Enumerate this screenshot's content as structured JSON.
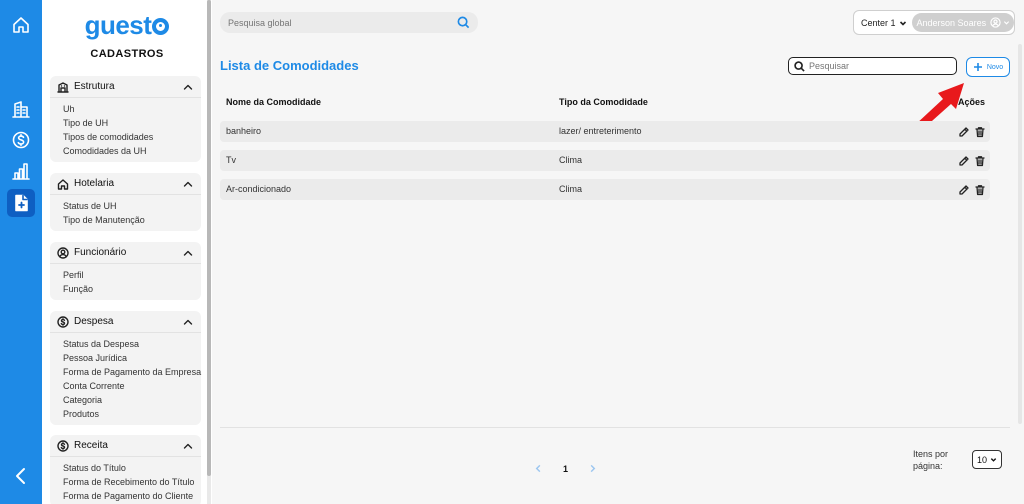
{
  "brand": {
    "text_pre": "guest"
  },
  "sidebar": {
    "title": "CADASTROS",
    "sections": [
      {
        "label": "Estrutura",
        "items": [
          "Uh",
          "Tipo de UH",
          "Tipos de comodidades",
          "Comodidades da UH"
        ]
      },
      {
        "label": "Hotelaria",
        "items": [
          "Status de UH",
          "Tipo de Manutenção"
        ]
      },
      {
        "label": "Funcionário",
        "items": [
          "Perfil",
          "Função"
        ]
      },
      {
        "label": "Despesa",
        "items": [
          "Status da Despesa",
          "Pessoa Jurídica",
          "Forma de Pagamento da Empresa",
          "Conta Corrente",
          "Categoria",
          "Produtos"
        ]
      },
      {
        "label": "Receita",
        "items": [
          "Status do Título",
          "Forma de Recebimento do Título",
          "Forma de Pagamento do Cliente"
        ]
      }
    ]
  },
  "header": {
    "global_search_placeholder": "Pesquisa global",
    "center": "Center 1",
    "user": "Anderson Soares"
  },
  "main": {
    "title": "Lista de Comodidades",
    "search_placeholder": "Pesquisar",
    "new_label": "Novo",
    "columns": [
      "Nome da Comodidade",
      "Tipo da Comodidade",
      "Ações"
    ],
    "rows": [
      {
        "name": "banheiro",
        "type": "lazer/ entreterimento"
      },
      {
        "name": "Tv",
        "type": "Clima"
      },
      {
        "name": "Ar-condicionado",
        "type": "Clima"
      }
    ]
  },
  "pagination": {
    "current_page": "1",
    "items_per_page_label": "Itens por página:",
    "items_per_page": "10"
  },
  "colors": {
    "accent": "#1e8ae6",
    "annotation_arrow": "#e8191c"
  }
}
